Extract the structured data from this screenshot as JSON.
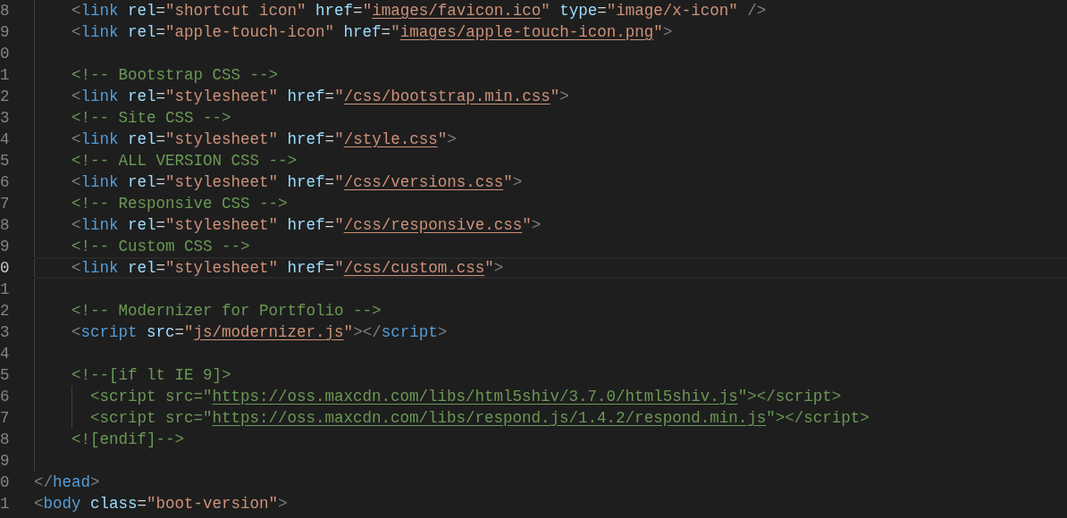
{
  "editor": {
    "lines": [
      {
        "number": "8",
        "current": false,
        "tokens": [
          {
            "kind": "punct",
            "text": "    <"
          },
          {
            "kind": "tag",
            "text": "link"
          },
          {
            "kind": "attr",
            "text": " rel"
          },
          {
            "kind": "eq",
            "text": "="
          },
          {
            "kind": "string",
            "text": "\"shortcut icon\""
          },
          {
            "kind": "attr",
            "text": " href"
          },
          {
            "kind": "eq",
            "text": "="
          },
          {
            "kind": "string",
            "text": "\""
          },
          {
            "kind": "link",
            "text": "images/favicon.ico"
          },
          {
            "kind": "string",
            "text": "\""
          },
          {
            "kind": "attr",
            "text": " type"
          },
          {
            "kind": "eq",
            "text": "="
          },
          {
            "kind": "string",
            "text": "\"image/x-icon\""
          },
          {
            "kind": "punct",
            "text": " />"
          }
        ]
      },
      {
        "number": "9",
        "current": false,
        "tokens": [
          {
            "kind": "punct",
            "text": "    <"
          },
          {
            "kind": "tag",
            "text": "link"
          },
          {
            "kind": "attr",
            "text": " rel"
          },
          {
            "kind": "eq",
            "text": "="
          },
          {
            "kind": "string",
            "text": "\"apple-touch-icon\""
          },
          {
            "kind": "attr",
            "text": " href"
          },
          {
            "kind": "eq",
            "text": "="
          },
          {
            "kind": "string",
            "text": "\""
          },
          {
            "kind": "link",
            "text": "images/apple-touch-icon.png"
          },
          {
            "kind": "string",
            "text": "\""
          },
          {
            "kind": "punct",
            "text": ">"
          }
        ]
      },
      {
        "number": "0",
        "current": false
      },
      {
        "number": "1",
        "current": false,
        "tokens": [
          {
            "kind": "comment",
            "text": "    <!-- Bootstrap CSS -->"
          }
        ]
      },
      {
        "number": "2",
        "current": false,
        "tokens": [
          {
            "kind": "punct",
            "text": "    <"
          },
          {
            "kind": "tag",
            "text": "link"
          },
          {
            "kind": "attr",
            "text": " rel"
          },
          {
            "kind": "eq",
            "text": "="
          },
          {
            "kind": "string",
            "text": "\"stylesheet\""
          },
          {
            "kind": "attr",
            "text": " href"
          },
          {
            "kind": "eq",
            "text": "="
          },
          {
            "kind": "string",
            "text": "\""
          },
          {
            "kind": "link",
            "text": "/css/bootstrap.min.css"
          },
          {
            "kind": "string",
            "text": "\""
          },
          {
            "kind": "punct",
            "text": ">"
          }
        ]
      },
      {
        "number": "3",
        "current": false,
        "tokens": [
          {
            "kind": "comment",
            "text": "    <!-- Site CSS -->"
          }
        ]
      },
      {
        "number": "4",
        "current": false,
        "tokens": [
          {
            "kind": "punct",
            "text": "    <"
          },
          {
            "kind": "tag",
            "text": "link"
          },
          {
            "kind": "attr",
            "text": " rel"
          },
          {
            "kind": "eq",
            "text": "="
          },
          {
            "kind": "string",
            "text": "\"stylesheet\""
          },
          {
            "kind": "attr",
            "text": " href"
          },
          {
            "kind": "eq",
            "text": "="
          },
          {
            "kind": "string",
            "text": "\""
          },
          {
            "kind": "link",
            "text": "/style.css"
          },
          {
            "kind": "string",
            "text": "\""
          },
          {
            "kind": "punct",
            "text": ">"
          }
        ]
      },
      {
        "number": "5",
        "current": false,
        "tokens": [
          {
            "kind": "comment",
            "text": "    <!-- ALL VERSION CSS -->"
          }
        ]
      },
      {
        "number": "6",
        "current": false,
        "tokens": [
          {
            "kind": "punct",
            "text": "    <"
          },
          {
            "kind": "tag",
            "text": "link"
          },
          {
            "kind": "attr",
            "text": " rel"
          },
          {
            "kind": "eq",
            "text": "="
          },
          {
            "kind": "string",
            "text": "\"stylesheet\""
          },
          {
            "kind": "attr",
            "text": " href"
          },
          {
            "kind": "eq",
            "text": "="
          },
          {
            "kind": "string",
            "text": "\""
          },
          {
            "kind": "link",
            "text": "/css/versions.css"
          },
          {
            "kind": "string",
            "text": "\""
          },
          {
            "kind": "punct",
            "text": ">"
          }
        ]
      },
      {
        "number": "7",
        "current": false,
        "tokens": [
          {
            "kind": "comment",
            "text": "    <!-- Responsive CSS -->"
          }
        ]
      },
      {
        "number": "8",
        "current": false,
        "tokens": [
          {
            "kind": "punct",
            "text": "    <"
          },
          {
            "kind": "tag",
            "text": "link"
          },
          {
            "kind": "attr",
            "text": " rel"
          },
          {
            "kind": "eq",
            "text": "="
          },
          {
            "kind": "string",
            "text": "\"stylesheet\""
          },
          {
            "kind": "attr",
            "text": " href"
          },
          {
            "kind": "eq",
            "text": "="
          },
          {
            "kind": "string",
            "text": "\""
          },
          {
            "kind": "link",
            "text": "/css/responsive.css"
          },
          {
            "kind": "string",
            "text": "\""
          },
          {
            "kind": "punct",
            "text": ">"
          }
        ]
      },
      {
        "number": "9",
        "current": false,
        "tokens": [
          {
            "kind": "comment",
            "text": "    <!-- Custom CSS -->"
          }
        ]
      },
      {
        "number": "0",
        "current": true,
        "tokens": [
          {
            "kind": "punct",
            "text": "    <"
          },
          {
            "kind": "tag",
            "text": "link"
          },
          {
            "kind": "attr",
            "text": " rel"
          },
          {
            "kind": "eq",
            "text": "="
          },
          {
            "kind": "string",
            "text": "\"stylesheet\""
          },
          {
            "kind": "attr",
            "text": " href"
          },
          {
            "kind": "eq",
            "text": "="
          },
          {
            "kind": "string",
            "text": "\""
          },
          {
            "kind": "link",
            "text": "/css/custom.css"
          },
          {
            "kind": "string",
            "text": "\""
          },
          {
            "kind": "punct",
            "text": ">"
          }
        ]
      },
      {
        "number": "1",
        "current": false
      },
      {
        "number": "2",
        "current": false,
        "tokens": [
          {
            "kind": "comment",
            "text": "    <!-- Modernizer for Portfolio -->"
          }
        ]
      },
      {
        "number": "3",
        "current": false,
        "tokens": [
          {
            "kind": "punct",
            "text": "    <"
          },
          {
            "kind": "tag",
            "text": "script"
          },
          {
            "kind": "attr",
            "text": " src"
          },
          {
            "kind": "eq",
            "text": "="
          },
          {
            "kind": "string",
            "text": "\""
          },
          {
            "kind": "link",
            "text": "js/modernizer.js"
          },
          {
            "kind": "string",
            "text": "\""
          },
          {
            "kind": "punct",
            "text": "></"
          },
          {
            "kind": "tag",
            "text": "script"
          },
          {
            "kind": "punct",
            "text": ">"
          }
        ]
      },
      {
        "number": "4",
        "current": false
      },
      {
        "number": "5",
        "current": false,
        "tokens": [
          {
            "kind": "comment",
            "text": "    <!--[if lt IE 9]>"
          }
        ]
      },
      {
        "number": "6",
        "current": false,
        "tokens": [
          {
            "kind": "comment",
            "text": "      <script src=\""
          },
          {
            "kind": "comment-link",
            "text": "https://oss.maxcdn.com/libs/html5shiv/3.7.0/html5shiv.js"
          },
          {
            "kind": "comment",
            "text": "\"></script>"
          }
        ]
      },
      {
        "number": "7",
        "current": false,
        "tokens": [
          {
            "kind": "comment",
            "text": "      <script src=\""
          },
          {
            "kind": "comment-link",
            "text": "https://oss.maxcdn.com/libs/respond.js/1.4.2/respond.min.js"
          },
          {
            "kind": "comment",
            "text": "\"></script>"
          }
        ]
      },
      {
        "number": "8",
        "current": false,
        "tokens": [
          {
            "kind": "comment",
            "text": "    <![endif]-->"
          }
        ]
      },
      {
        "number": "9",
        "current": false
      },
      {
        "number": "0",
        "current": false,
        "tokens": [
          {
            "kind": "punct",
            "text": "</"
          },
          {
            "kind": "tag",
            "text": "head"
          },
          {
            "kind": "punct",
            "text": ">"
          }
        ]
      },
      {
        "number": "1",
        "current": false,
        "tokens": [
          {
            "kind": "punct",
            "text": "<"
          },
          {
            "kind": "tag",
            "text": "body"
          },
          {
            "kind": "attr",
            "text": " class"
          },
          {
            "kind": "eq",
            "text": "="
          },
          {
            "kind": "string",
            "text": "\"boot-version\""
          },
          {
            "kind": "punct",
            "text": ">"
          }
        ]
      }
    ]
  }
}
